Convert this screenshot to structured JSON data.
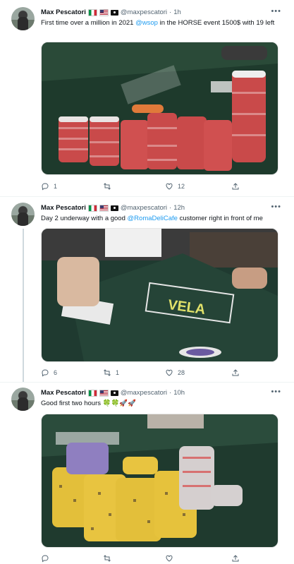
{
  "tweets": [
    {
      "name": "Max Pescatori",
      "handle": "@maxpescatori",
      "dot": "·",
      "time": "1h",
      "text_before": "First time over a million in 2021 ",
      "mention": "@wsop",
      "text_after": " in the HORSE event 1500$ with 19 left",
      "image_alt": "Stacks of red and white poker chips on a WSOP table",
      "actions": {
        "reply": "1",
        "retweet": "",
        "like": "12"
      }
    },
    {
      "name": "Max Pescatori",
      "handle": "@maxpescatori",
      "dot": "·",
      "time": "12h",
      "text_before": "Day 2 underway with a good ",
      "mention": "@RomaDeliCafe",
      "text_after": " customer right in front of me",
      "image_alt": "Hand on a poker table with cards and Vela logo",
      "actions": {
        "reply": "6",
        "retweet": "1",
        "like": "28"
      }
    },
    {
      "name": "Max Pescatori",
      "handle": "@maxpescatori",
      "dot": "·",
      "time": "10h",
      "text_before": "Good first two hours 🍀🍀🚀🚀",
      "mention": "",
      "text_after": "",
      "image_alt": "Stacks of yellow and purple poker chips",
      "actions": {
        "reply": "",
        "retweet": "",
        "like": ""
      }
    }
  ],
  "colors": {
    "accent": "#1d9bf0",
    "muted": "#536471",
    "table_green": "#1f3d2f"
  },
  "icons": [
    "more-icon",
    "reply-icon",
    "retweet-icon",
    "like-icon",
    "share-icon"
  ]
}
